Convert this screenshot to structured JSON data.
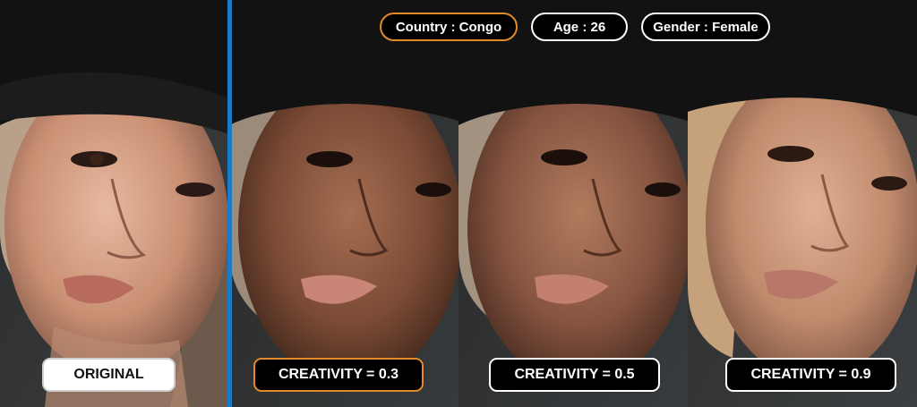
{
  "attributes": {
    "country": "Country : Congo",
    "age": "Age : 26",
    "gender": "Gender : Female"
  },
  "panels": [
    {
      "label": "ORIGINAL"
    },
    {
      "label": "CREATIVITY = 0.3"
    },
    {
      "label": "CREATIVITY = 0.5"
    },
    {
      "label": "CREATIVITY = 0.9"
    }
  ],
  "colors": {
    "accent_orange": "#e08a2a",
    "divider_blue": "#1a7ac4",
    "pill_background": "#000000",
    "pill_border": "#ffffff"
  }
}
